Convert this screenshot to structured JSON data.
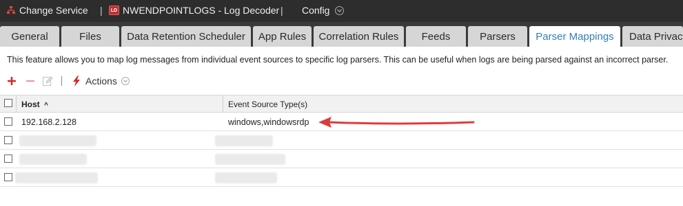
{
  "topbar": {
    "change_service": "Change Service",
    "separator": "|",
    "device_badge": "LD",
    "device": "NWENDPOINTLOGS - Log Decoder",
    "config": "Config"
  },
  "tabs": [
    {
      "label": "General"
    },
    {
      "label": "Files"
    },
    {
      "label": "Data Retention Scheduler"
    },
    {
      "label": "App Rules"
    },
    {
      "label": "Correlation Rules"
    },
    {
      "label": "Feeds"
    },
    {
      "label": "Parsers"
    },
    {
      "label": "Parser Mappings",
      "active": true
    },
    {
      "label": "Data Privacy"
    }
  ],
  "description": "This feature allows you to map log messages from individual event sources to specific log parsers. This can be useful when logs are being parsed against an incorrect parser.",
  "toolbar": {
    "separator": "|",
    "actions_label": "Actions"
  },
  "table": {
    "columns": {
      "host": "Host",
      "host_sort": "^",
      "event_source_types": "Event Source Type(s)"
    },
    "rows": [
      {
        "host": "192.168.2.128",
        "event_source_types": "windows,windowsrdp"
      },
      {
        "host": "",
        "event_source_types": ""
      },
      {
        "host": "",
        "event_source_types": ""
      },
      {
        "host": "",
        "event_source_types": ""
      }
    ]
  },
  "colors": {
    "topbar_bg": "#2d2d2d",
    "tab_active_text": "#2f7fb8",
    "add_icon": "#d32a2a",
    "annotation_arrow": "#e03a3a"
  }
}
